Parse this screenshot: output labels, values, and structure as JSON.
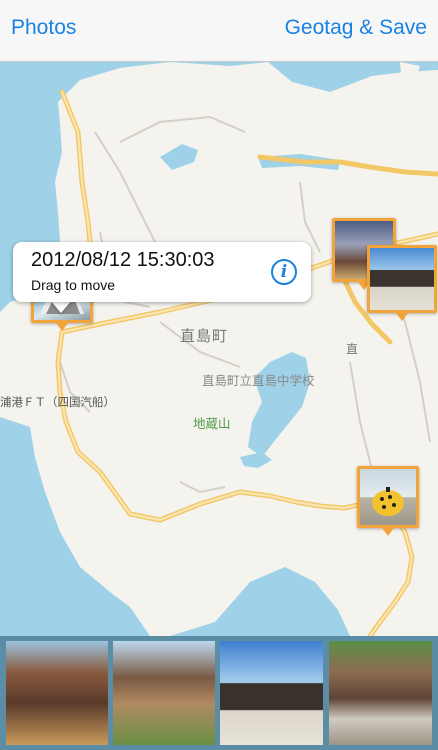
{
  "nav": {
    "back_label": "Photos",
    "action_label": "Geotag & Save"
  },
  "callout": {
    "datetime": "2012/08/12 15:30:03",
    "hint": "Drag to move",
    "info_icon": "info-icon"
  },
  "map_labels": {
    "town": "直島町",
    "school": "直島町立直島中学校",
    "mountain": "地蔵山",
    "port": "浦港ＦＴ（四国汽船）",
    "partial": "直"
  },
  "pins": [
    {
      "id": "pin-dragged",
      "subject": "building-up-view"
    },
    {
      "id": "pin-house-1",
      "subject": "house"
    },
    {
      "id": "pin-house-2",
      "subject": "barn"
    },
    {
      "id": "pin-pumpkin",
      "subject": "yellow-pumpkin"
    }
  ],
  "thumbnails": [
    {
      "subject": "wooden-house"
    },
    {
      "subject": "junk-house"
    },
    {
      "subject": "black-barn"
    },
    {
      "subject": "stone-wall-house"
    }
  ],
  "colors": {
    "accent": "#1a82e2",
    "pin": "#f2a43a",
    "sea": "#9fd2e8",
    "land": "#f5f3ee",
    "road": "#f7d27d",
    "strip": "#5b8ea6"
  }
}
